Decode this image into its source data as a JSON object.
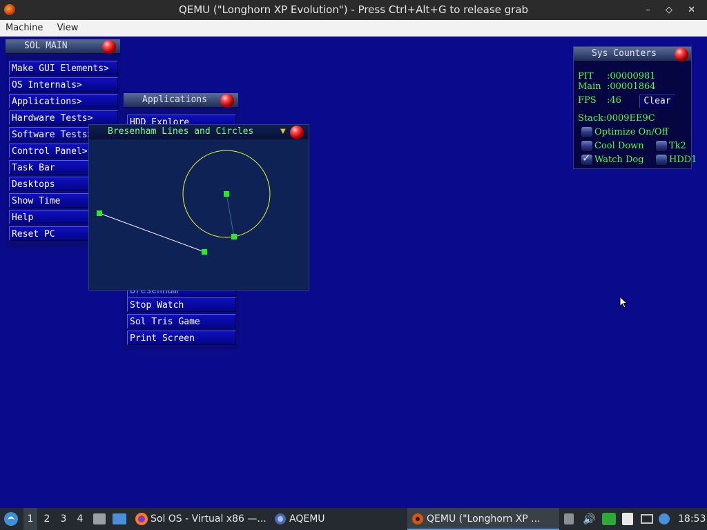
{
  "host": {
    "title": "QEMU (\"Longhorn XP Evolution\") - Press Ctrl+Alt+G to release grab",
    "controls": "– ◇ ✕",
    "menu": [
      "Machine",
      "View"
    ]
  },
  "sol_main": {
    "title": "SOL MAIN",
    "items": [
      "Make GUI Elements>",
      "OS Internals>",
      "Applications>",
      "Hardware Tests>",
      "Software Tests>",
      "Control Panel>",
      "Task Bar",
      "Desktops",
      "Show Time",
      "Help",
      "Reset PC"
    ]
  },
  "applications": {
    "title": "Applications",
    "items": [
      "HDD Explore",
      "Bresenham",
      "Stop Watch",
      "Sol Tris Game",
      "Print Screen"
    ]
  },
  "bresenham": {
    "title": "Bresenham Lines and Circles",
    "drop_glyph": "▼"
  },
  "sys_counters": {
    "title": "Sys Counters",
    "pit_label": "PIT",
    "pit_value": ":00000981",
    "main_label": "Main",
    "main_value": ":00001864",
    "fps_label": "FPS",
    "fps_value": ":46",
    "clear_label": "Clear",
    "stack_label": "Stack:0009EE9C",
    "checkboxes": [
      {
        "label": "Optimize On/Off",
        "checked": false
      },
      {
        "label": "Cool Down",
        "checked": false
      },
      {
        "label": "Watch Dog",
        "checked": true
      },
      {
        "label": "Tk2",
        "checked": false
      },
      {
        "label": "HDD1",
        "checked": false
      }
    ]
  },
  "taskbar": {
    "workspaces": [
      "1",
      "2",
      "3",
      "4"
    ],
    "tasks": [
      "Sol OS - Virtual x86 —...",
      "AQEMU",
      "QEMU (\"Longhorn XP ..."
    ],
    "clock": "18:53"
  },
  "colors": {
    "desktop": "#0a0a8c",
    "menu_item": "#0808a0",
    "counter_text": "#49ff49",
    "circle": "#e6ff33",
    "handle": "#22ee22",
    "bresenham_canvas": "#0e2256"
  }
}
